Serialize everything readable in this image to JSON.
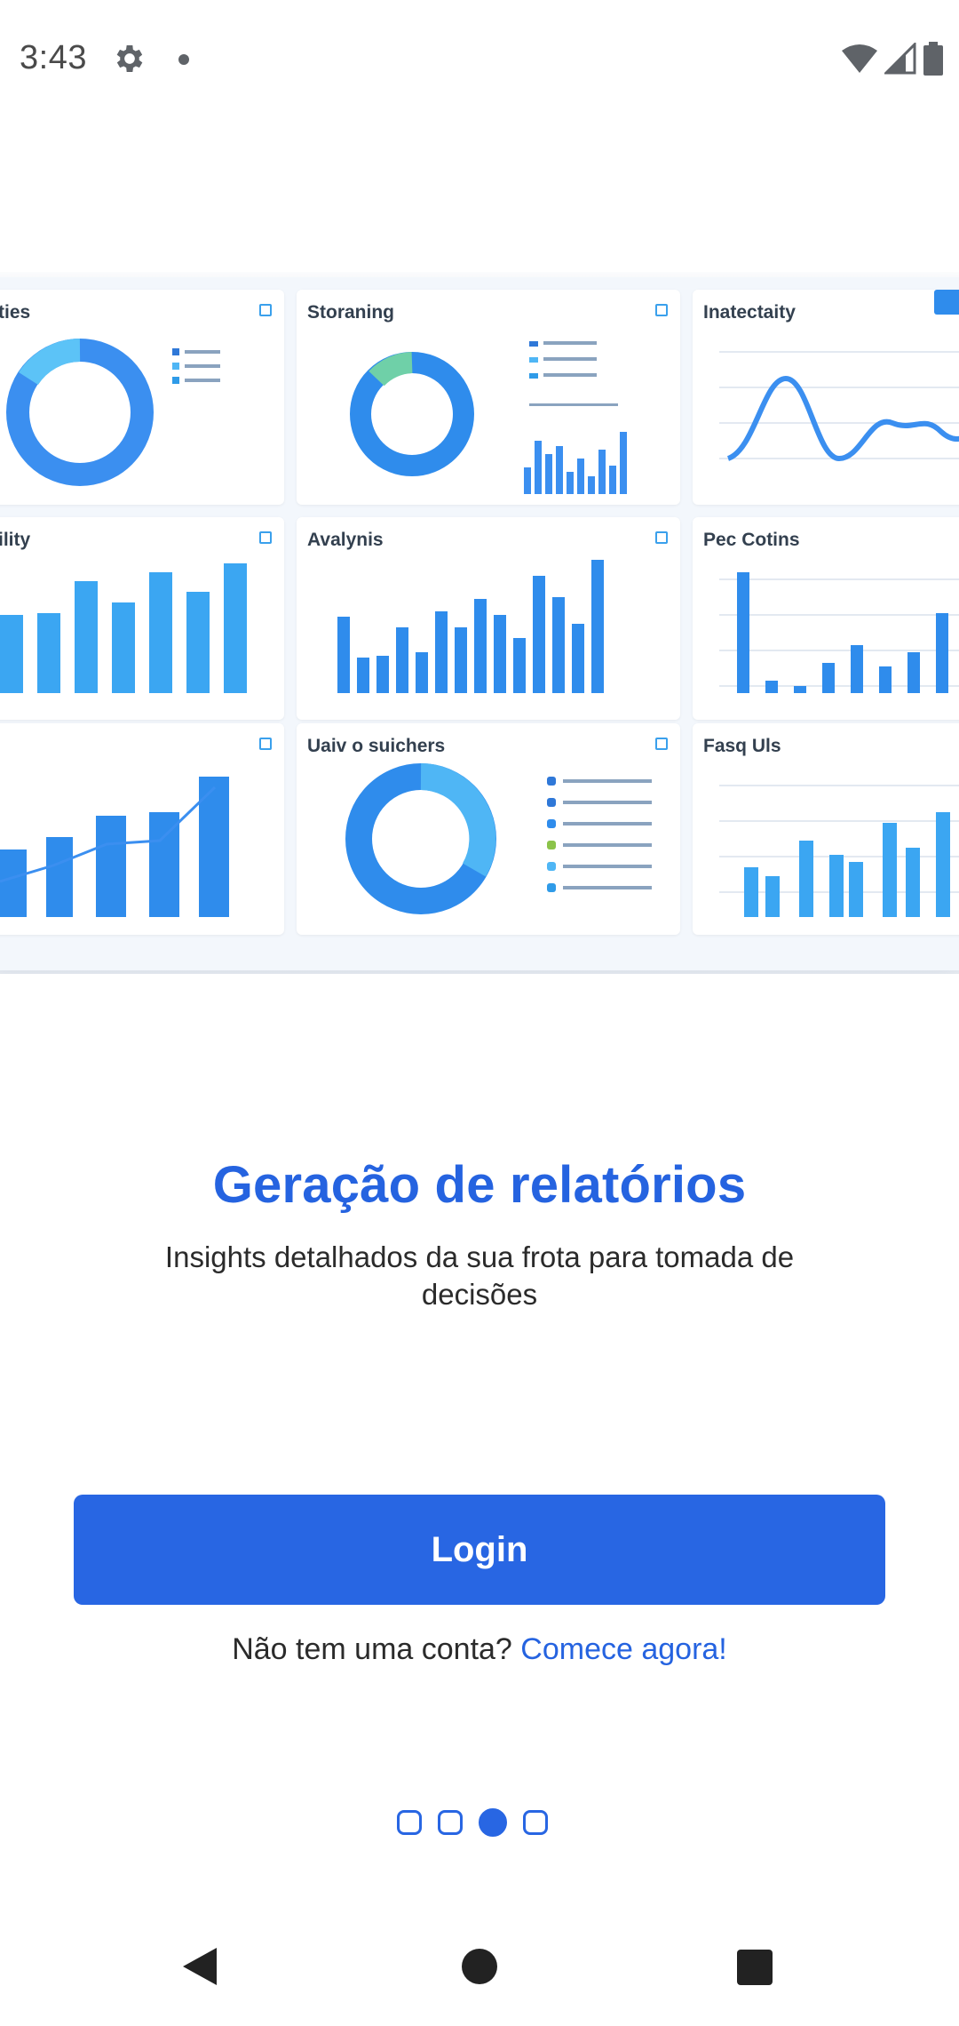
{
  "status_bar": {
    "time": "3:43",
    "icons": [
      "gear-icon",
      "notification-dot-icon",
      "wifi-icon",
      "signal-icon",
      "battery-icon"
    ]
  },
  "illustration": {
    "description_icon": "dashboard-illustration",
    "cards": [
      {
        "title": "ties"
      },
      {
        "title": "Storaning"
      },
      {
        "title": "Inatectaity"
      },
      {
        "title": "ility"
      },
      {
        "title": "Avalynis"
      },
      {
        "title": "Pec Cotins"
      },
      {
        "title": ""
      },
      {
        "title": "Uaiv o suichers"
      },
      {
        "title": "Fasq Uls"
      }
    ]
  },
  "onboarding": {
    "title": "Geração de relatórios",
    "subtitle": "Insights detalhados da sua frota para tomada de decisões",
    "login_label": "Login",
    "signup_prompt": "Não tem uma conta?",
    "signup_link": "Comece agora!",
    "pages_total": 4,
    "active_page": 3
  },
  "colors": {
    "primary": "#2866e3",
    "title_blue": "#2563e0",
    "chart_blue": "#3b8ff0",
    "chart_light": "#4fb6f5"
  },
  "nav_bar": {
    "icons": [
      "back-icon",
      "home-icon",
      "recents-icon"
    ]
  }
}
